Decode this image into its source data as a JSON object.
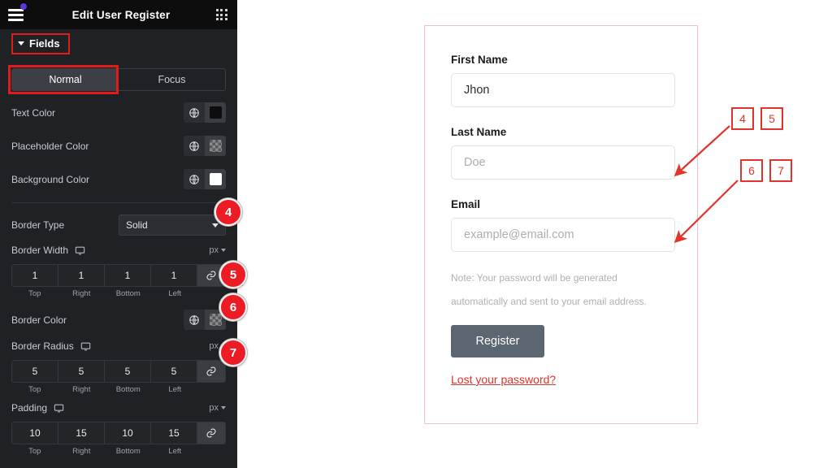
{
  "panel": {
    "header": {
      "title": "Edit User Register",
      "menu_icon": "hamburger-icon",
      "apps_icon": "grid-apps-icon",
      "notification_dot": true
    },
    "section": {
      "label": "Fields",
      "expanded": true
    },
    "tabs": [
      {
        "label": "Normal",
        "active": true
      },
      {
        "label": "Focus",
        "active": false
      }
    ],
    "color_controls": [
      {
        "label": "Text Color",
        "swatch": "#0d0d0d",
        "swatch_type": "solid"
      },
      {
        "label": "Placeholder Color",
        "swatch": "",
        "swatch_type": "transparent"
      },
      {
        "label": "Background Color",
        "swatch": "#ffffff",
        "swatch_type": "solid"
      }
    ],
    "border_type": {
      "label": "Border Type",
      "value": "Solid"
    },
    "border_width": {
      "label": "Border Width",
      "unit": "px",
      "values": [
        "1",
        "1",
        "1",
        "1"
      ],
      "sides": [
        "Top",
        "Right",
        "Bottom",
        "Left"
      ],
      "linked": true
    },
    "border_color": {
      "label": "Border Color",
      "swatch_type": "transparent"
    },
    "border_radius": {
      "label": "Border Radius",
      "unit": "px",
      "values": [
        "5",
        "5",
        "5",
        "5"
      ],
      "sides": [
        "Top",
        "Right",
        "Bottom",
        "Left"
      ],
      "linked": true
    },
    "padding": {
      "label": "Padding",
      "unit": "px",
      "values": [
        "10",
        "15",
        "10",
        "15"
      ],
      "sides": [
        "Top",
        "Right",
        "Bottom",
        "Left"
      ],
      "linked": true
    },
    "badges": [
      "4",
      "5",
      "6",
      "7"
    ],
    "collapse_icon": "chevron-left-icon"
  },
  "preview": {
    "fields": [
      {
        "label": "First Name",
        "value": "Jhon",
        "is_placeholder": false
      },
      {
        "label": "Last Name",
        "value": "Doe",
        "is_placeholder": true
      },
      {
        "label": "Email",
        "value": "example@email.com",
        "is_placeholder": true
      }
    ],
    "note_line1": "Note: Your password will be generated",
    "note_line2": "automatically and sent to your email address.",
    "submit_label": "Register",
    "lost_password_label": "Lost your password?"
  },
  "callouts": {
    "squares": [
      "4",
      "5",
      "6",
      "7"
    ]
  },
  "colors": {
    "panel_bg": "#1f2124",
    "header_bg": "#0d0d0d",
    "accent_red": "#ed1c24",
    "badge_border": "#e0342c",
    "form_border": "#f0bcd8",
    "button_bg": "#5b6670",
    "link_red": "#e0312b",
    "notification_dot": "#5a35e0"
  }
}
